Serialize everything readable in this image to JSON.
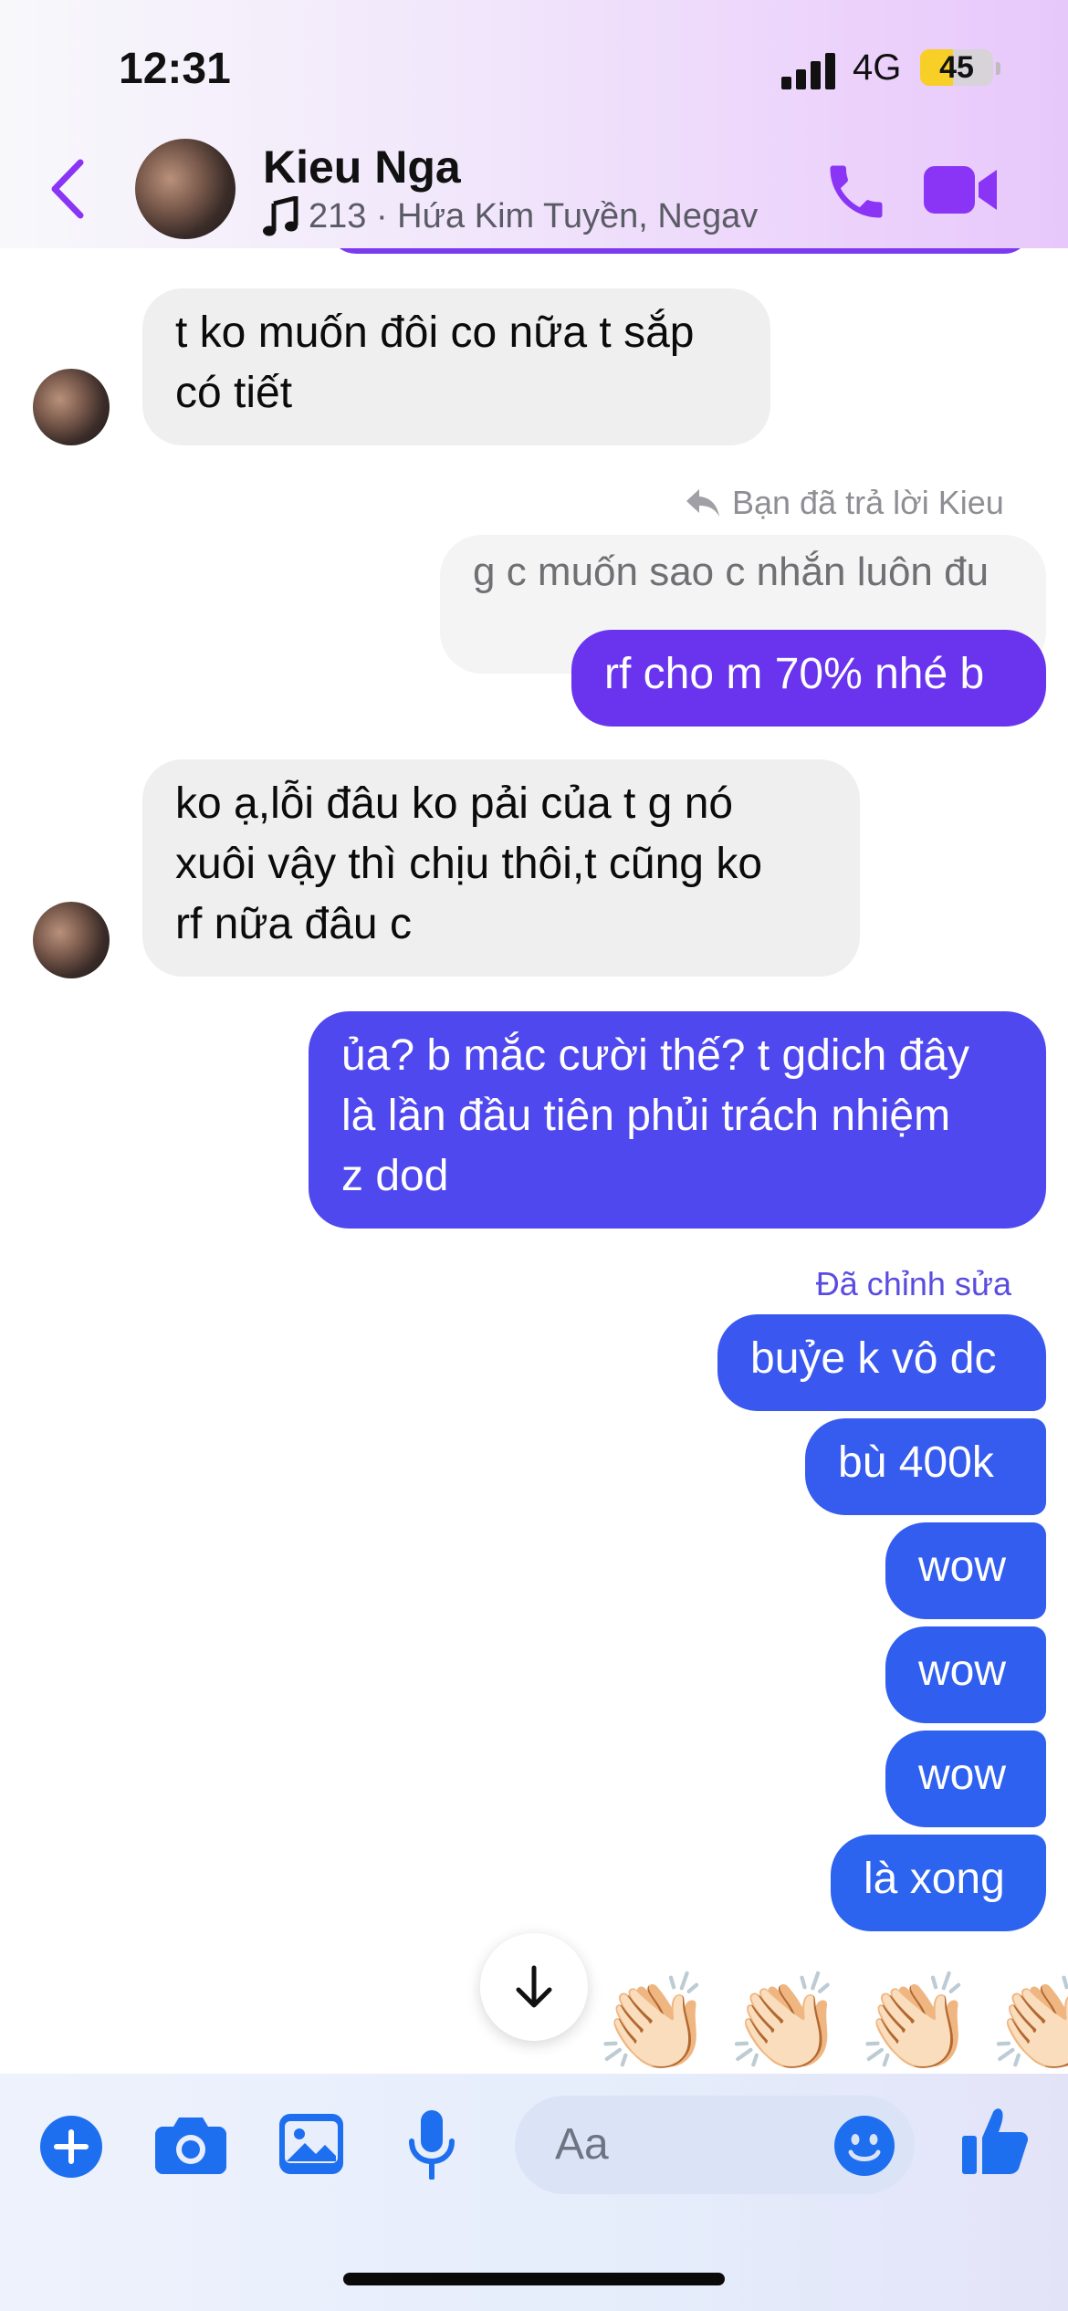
{
  "status": {
    "time": "12:31",
    "network": "4G",
    "battery": "45",
    "battery_level": 0.45
  },
  "header": {
    "contact_name": "Kieu Nga",
    "music_text": "213 · Hứa Kim Tuyền, Negav",
    "icons": {
      "back": "chevron-left-icon",
      "call": "phone-icon",
      "video": "video-camera-icon",
      "music": "music-note-icon"
    }
  },
  "colors": {
    "accent": "#8a35f5",
    "outgoing_purple": "#6a34ef",
    "outgoing_blue": "#2f5fef",
    "incoming": "#efefef",
    "composer_blue": "#1e6ff0"
  },
  "messages": {
    "m1": "t ko muốn đôi co nữa t sắp",
    "m1b": "có tiết",
    "reply_label": "Bạn đã trả lời Kieu",
    "quoted": "g c muốn sao c nhắn luôn đu",
    "m2": "rf cho m 70% nhé b",
    "m3a": "ko ạ,lỗi đâu ko pải của t g nó",
    "m3b": "xuôi  vậy thì chịu thôi,t cũng ko",
    "m3c": "rf nữa đâu c",
    "m4a": "ủa? b mắc cười thế? t gdich đây",
    "m4b": "là lần đầu tiên phủi trách nhiệm",
    "m4c": "z dod",
    "edited_label": "Đã chỉnh sửa",
    "m5": "buỷe k vô dc",
    "m6": "bù 400k",
    "m7": "wow",
    "m8": "wow",
    "m9": "wow",
    "m10": "là xong",
    "reactions": [
      "👏🏻",
      "👏🏻",
      "👏🏻",
      "👏🏻"
    ]
  },
  "composer": {
    "placeholder": "Aa",
    "icons": [
      "plus-icon",
      "camera-icon",
      "image-icon",
      "microphone-icon",
      "emoji-icon",
      "thumbs-up-icon"
    ]
  }
}
